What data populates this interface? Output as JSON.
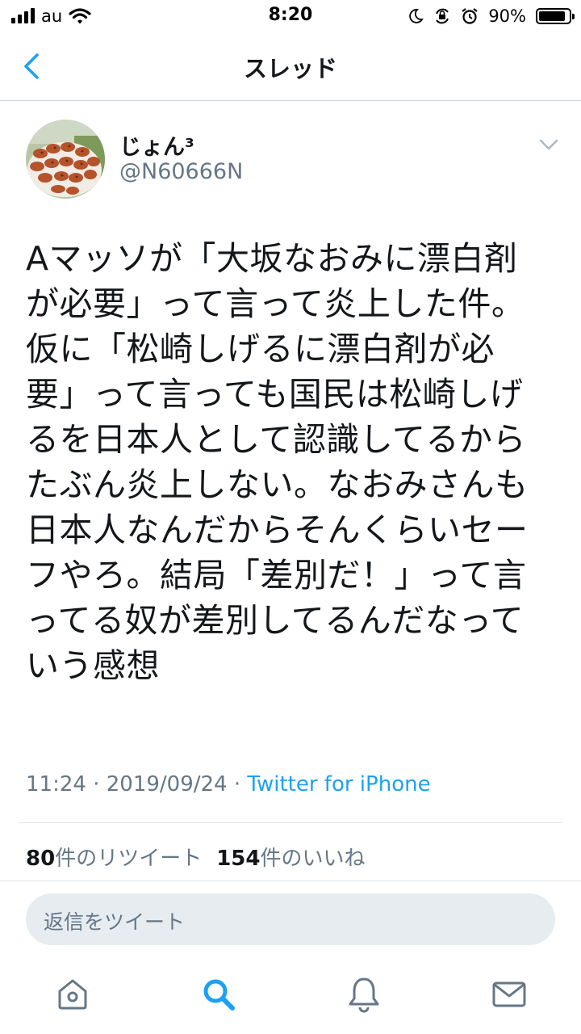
{
  "status_bar": {
    "carrier": "au",
    "time": "8:20",
    "battery_percent": "90%",
    "battery_level": 0.9,
    "icons": [
      "signal-bars-icon",
      "wifi-icon",
      "moon-icon",
      "orientation-lock-icon",
      "alarm-icon",
      "battery-icon"
    ]
  },
  "nav": {
    "title": "スレッド",
    "back_icon": "chevron-left-icon"
  },
  "tweet": {
    "display_name": "じょん³",
    "handle": "@N60666N",
    "text": "Aマッソが「大坂なおみに漂白剤\nが必要」って言って炎上した件。\n仮に「松崎しげるに漂白剤が必\n要」って言っても国民は松崎しげ\nるを日本人として認識してるから\nたぶん炎上しない。なおみさんも\n日本人なんだからそんくらいセー\nフやろ。結局「差別だ！」って言\nってる奴が差別してるんだなって\nいう感想",
    "time": "11:24",
    "separator": "·",
    "date": "2019/09/24",
    "source": "Twitter for iPhone",
    "retweet_count": "80",
    "retweet_label": "件のリツイート",
    "like_count": "154",
    "like_label": "件のいいね",
    "more_icon": "chevron-down-icon"
  },
  "reply": {
    "placeholder": "返信をツイート"
  },
  "tab_bar": {
    "tabs": [
      {
        "name": "home",
        "icon": "home-icon"
      },
      {
        "name": "search",
        "icon": "search-icon",
        "active": true
      },
      {
        "name": "notifications",
        "icon": "bell-icon"
      },
      {
        "name": "messages",
        "icon": "mail-icon"
      }
    ]
  },
  "colors": {
    "accent": "#1da1f2",
    "secondary_text": "#657786",
    "primary_text": "#14171a",
    "reply_bg": "#e6ecf0"
  }
}
